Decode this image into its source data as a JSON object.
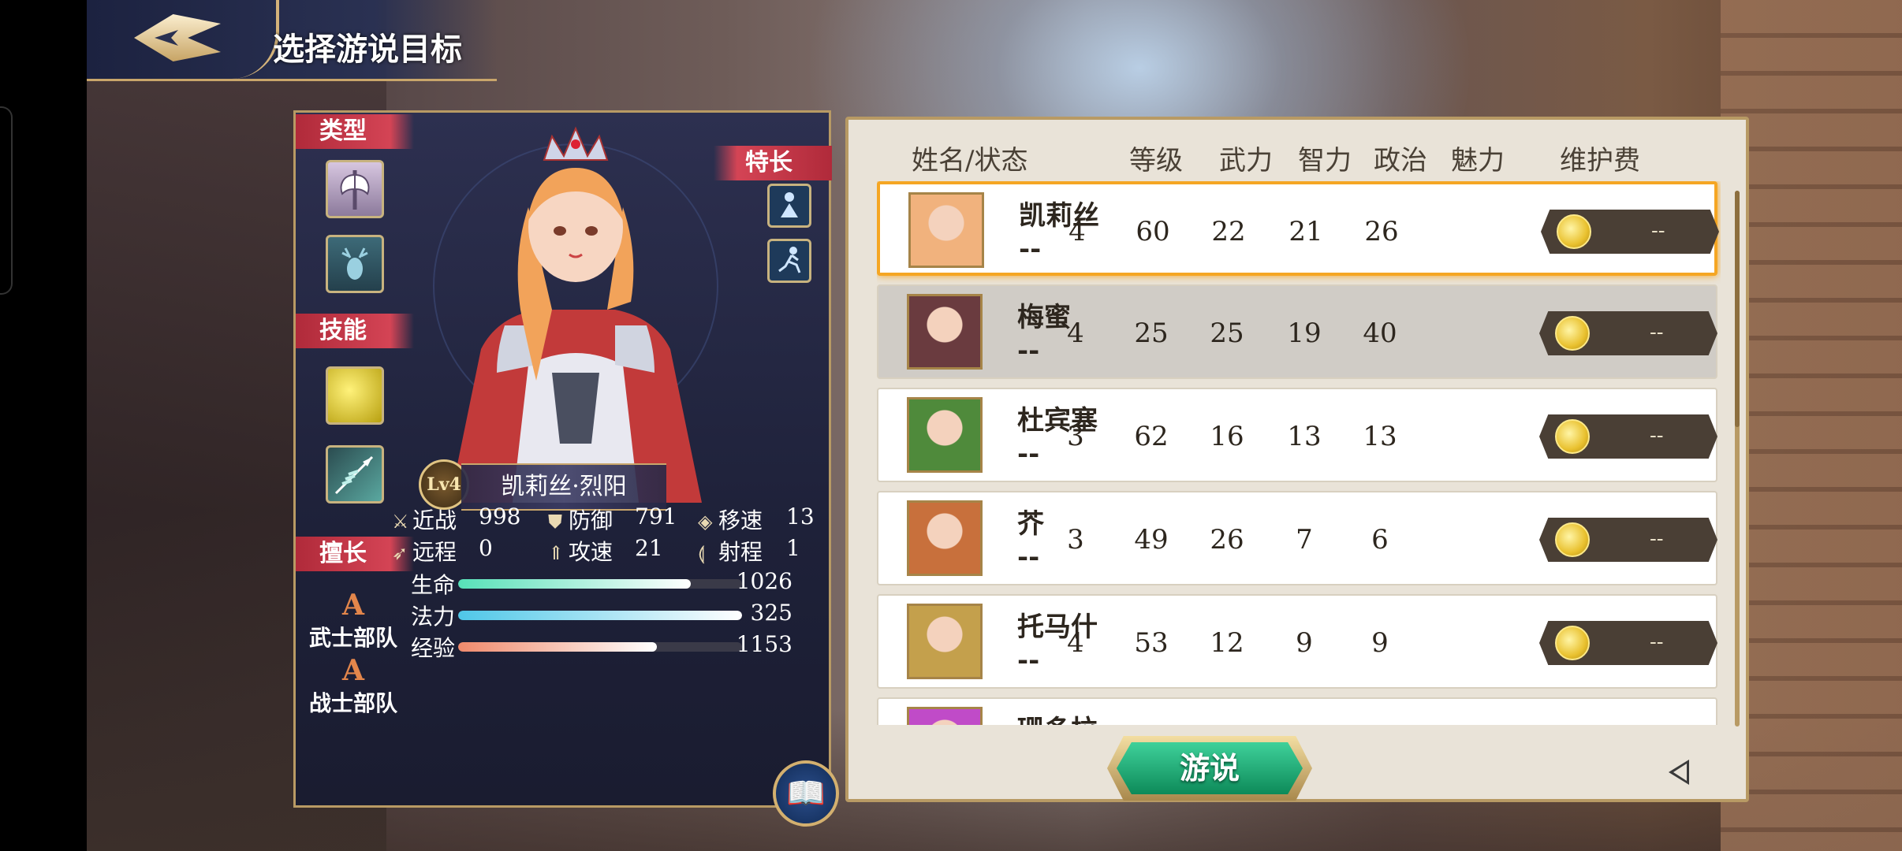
{
  "header": {
    "title": "选择游说目标"
  },
  "char_panel": {
    "type_label": "类型",
    "skill_label": "技能",
    "trait_label": "特长",
    "expert_label": "擅长",
    "type_icons": [
      "axe-icon",
      "deer-icon"
    ],
    "skill_icons": [
      "golden-sparkle-icon",
      "feather-arrow-icon"
    ],
    "trait_icons": [
      "figure-icon",
      "runner-icon"
    ],
    "level": "Lv4",
    "name": "凯莉丝·烈阳",
    "stats": [
      {
        "icon": "sword-icon",
        "label": "近战",
        "value": "998"
      },
      {
        "icon": "shield-icon",
        "label": "防御",
        "value": "791"
      },
      {
        "icon": "move-icon",
        "label": "移速",
        "value": "13"
      },
      {
        "icon": "bow-icon",
        "label": "远程",
        "value": "0"
      },
      {
        "icon": "arrow-up-icon",
        "label": "攻速",
        "value": "21"
      },
      {
        "icon": "range-icon",
        "label": "射程",
        "value": "1"
      }
    ],
    "bars": [
      {
        "label": "生命",
        "value": "1026",
        "fill": 0.82,
        "color": "#57e0b8"
      },
      {
        "label": "法力",
        "value": "325",
        "fill": 1.0,
        "color": "#4fc7e8"
      },
      {
        "label": "经验",
        "value": "1153",
        "fill": 0.7,
        "color": "#f08a6c"
      }
    ],
    "experts": [
      {
        "rank": "A",
        "name": "武士部队"
      },
      {
        "rank": "A",
        "name": "战士部队"
      }
    ]
  },
  "list": {
    "columns": {
      "name_status": "姓名/状态",
      "level": "等级",
      "force": "武力",
      "intel": "智力",
      "politics": "政治",
      "charm": "魅力",
      "upkeep": "维护费"
    },
    "rows": [
      {
        "name": "凯莉丝",
        "status": "--",
        "level": "4",
        "force": "60",
        "intel": "22",
        "politics": "21",
        "charm": "26",
        "upkeep": "--",
        "avatar_color": "#f1b27d"
      },
      {
        "name": "梅蜜",
        "status": "--",
        "level": "4",
        "force": "25",
        "intel": "25",
        "politics": "19",
        "charm": "40",
        "upkeep": "--",
        "avatar_color": "#6a3b3f"
      },
      {
        "name": "杜宾塞",
        "status": "--",
        "level": "3",
        "force": "62",
        "intel": "16",
        "politics": "13",
        "charm": "13",
        "upkeep": "--",
        "avatar_color": "#4f8a3b"
      },
      {
        "name": "芥",
        "status": "--",
        "level": "3",
        "force": "49",
        "intel": "26",
        "politics": "7",
        "charm": "6",
        "upkeep": "--",
        "avatar_color": "#c8703c"
      },
      {
        "name": "托马什",
        "status": "--",
        "level": "4",
        "force": "53",
        "intel": "12",
        "politics": "9",
        "charm": "9",
        "upkeep": "--",
        "avatar_color": "#c4a04c"
      },
      {
        "name": "珊多拉",
        "status": "",
        "level": "",
        "force": "",
        "intel": "",
        "politics": "",
        "charm": "",
        "upkeep": "",
        "avatar_color": "#c04bc8"
      }
    ],
    "persuade_label": "游说"
  }
}
